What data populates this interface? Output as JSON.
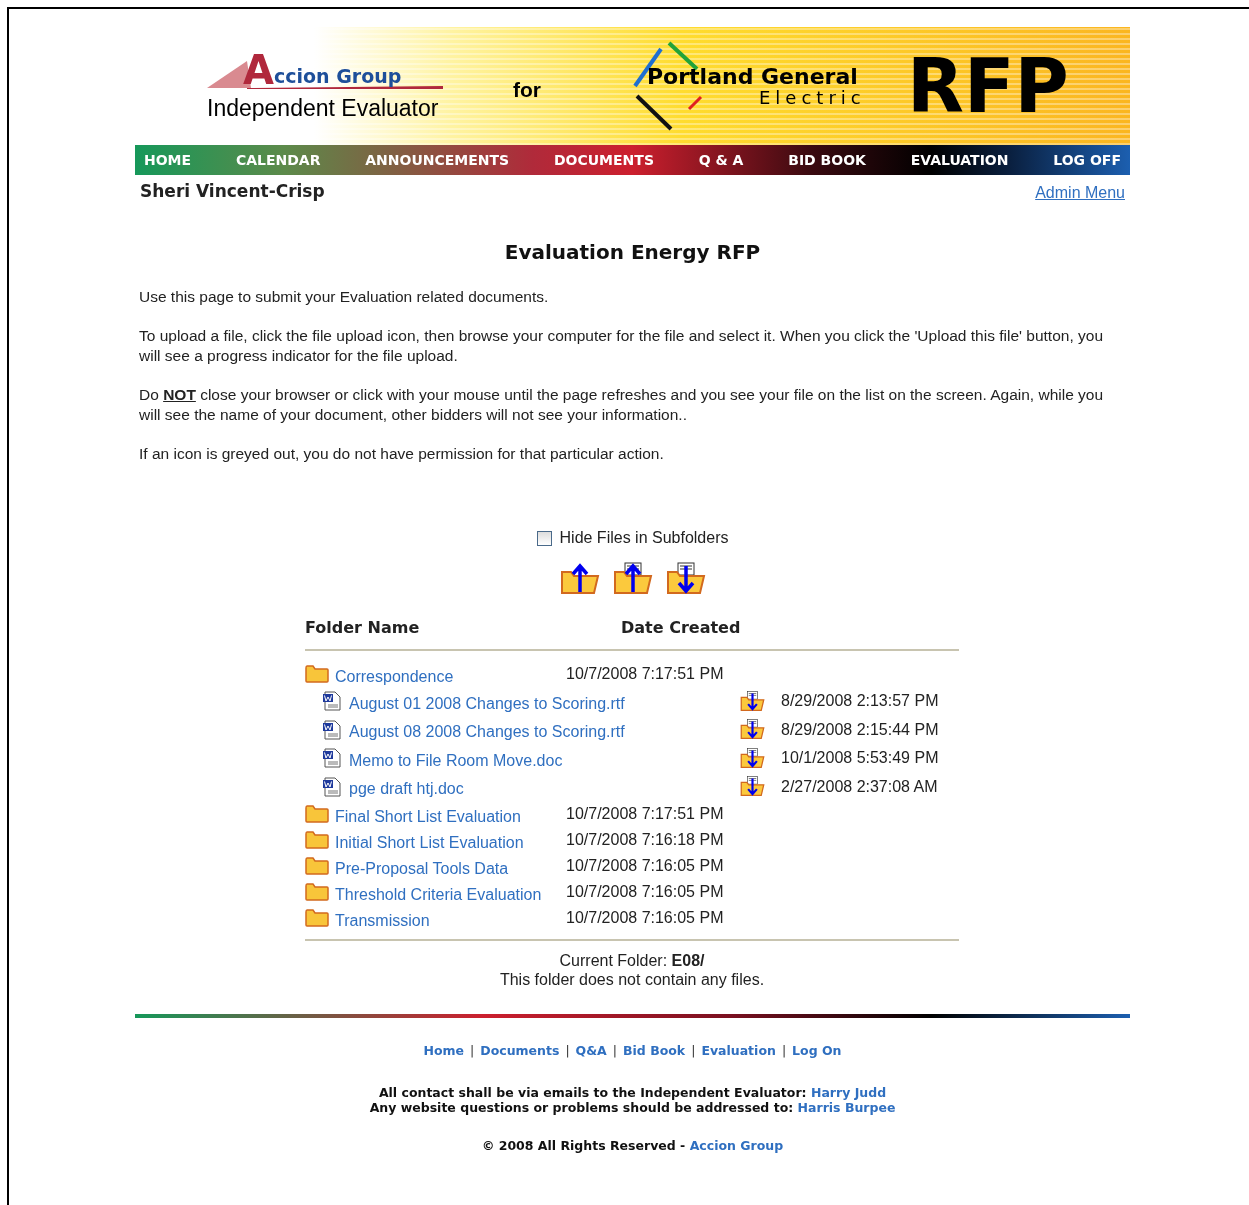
{
  "header": {
    "logo_initial": "A",
    "logo_rest": "ccion Group",
    "logo_subtitle": "Independent Evaluator",
    "for_text": "for",
    "client_line1": "Portland General",
    "client_line2": "Electric",
    "rfp": "RFP"
  },
  "nav": [
    {
      "label": "HOME"
    },
    {
      "label": "CALENDAR"
    },
    {
      "label": "ANNOUNCEMENTS"
    },
    {
      "label": "DOCUMENTS"
    },
    {
      "label": "Q & A"
    },
    {
      "label": "BID BOOK"
    },
    {
      "label": "EVALUATION"
    },
    {
      "label": "LOG OFF"
    }
  ],
  "user": "Sheri Vincent-Crisp",
  "admin_link": "Admin Menu",
  "title": "Evaluation Energy RFP",
  "paragraphs": [
    {
      "before": "Use this page to submit your Evaluation related documents."
    },
    {
      "before": "To upload a file, click the file upload icon, then browse your computer for the file and select it. When you click the 'Upload this file' button, you will see a progress indicator for the file upload."
    },
    {
      "before": "Do ",
      "underlined": "NOT",
      "after": " close your browser or click with your mouse until the page refreshes and you see your file on the list on the screen.  Again, while you will see the name of your document, other bidders will not see your information.."
    },
    {
      "before": "If an icon is greyed out, you do not have permission for that particular action."
    }
  ],
  "hide_files": {
    "label": "Hide Files in Subfolders",
    "checked": false
  },
  "columns": [
    "Folder Name",
    "Date Created"
  ],
  "folders": [
    {
      "name": "Correspondence",
      "date": "10/7/2008 7:17:51 PM",
      "children": [
        {
          "name": "August 01 2008 Changes to Scoring.rtf",
          "date": "8/29/2008 2:13:57 PM"
        },
        {
          "name": "August 08 2008 Changes to Scoring.rtf",
          "date": "8/29/2008 2:15:44 PM"
        },
        {
          "name": "Memo to File Room Move.doc",
          "date": "10/1/2008 5:53:49 PM"
        },
        {
          "name": "pge draft htj.doc",
          "date": "2/27/2008 2:37:08 AM"
        }
      ]
    },
    {
      "name": "Final Short List Evaluation",
      "date": "10/7/2008 7:17:51 PM"
    },
    {
      "name": "Initial Short List Evaluation",
      "date": "10/7/2008 7:16:18 PM"
    },
    {
      "name": "Pre-Proposal Tools Data",
      "date": "10/7/2008 7:16:05 PM"
    },
    {
      "name": "Threshold Criteria Evaluation",
      "date": "10/7/2008 7:16:05 PM"
    },
    {
      "name": "Transmission",
      "date": "10/7/2008 7:16:05 PM"
    }
  ],
  "current_folder": {
    "label": "Current Folder: ",
    "value": "E08/"
  },
  "empty_message": "This folder does not contain any files.",
  "footer": {
    "nav": [
      {
        "kind": "link",
        "text": "Home"
      },
      {
        "kind": "separator",
        "text": "|"
      },
      {
        "kind": "link",
        "text": "Documents"
      },
      {
        "kind": "separator",
        "text": "|"
      },
      {
        "kind": "link",
        "text": "Q&A"
      },
      {
        "kind": "separator",
        "text": "|"
      },
      {
        "kind": "link",
        "text": "Bid Book"
      },
      {
        "kind": "separator",
        "text": "|"
      },
      {
        "kind": "link",
        "text": "Evaluation"
      },
      {
        "kind": "separator",
        "text": "|"
      },
      {
        "kind": "link",
        "text": "Log On"
      }
    ],
    "contacts": [
      {
        "text": "All contact shall be via emails to the Independent Evaluator: ",
        "link": "Harry Judd"
      },
      {
        "text": "Any website questions or problems should be addressed to: ",
        "link": "Harris Burpee"
      }
    ],
    "copyright": "© 2008 All Rights Reserved - ",
    "copyright_link": "Accion Group"
  }
}
